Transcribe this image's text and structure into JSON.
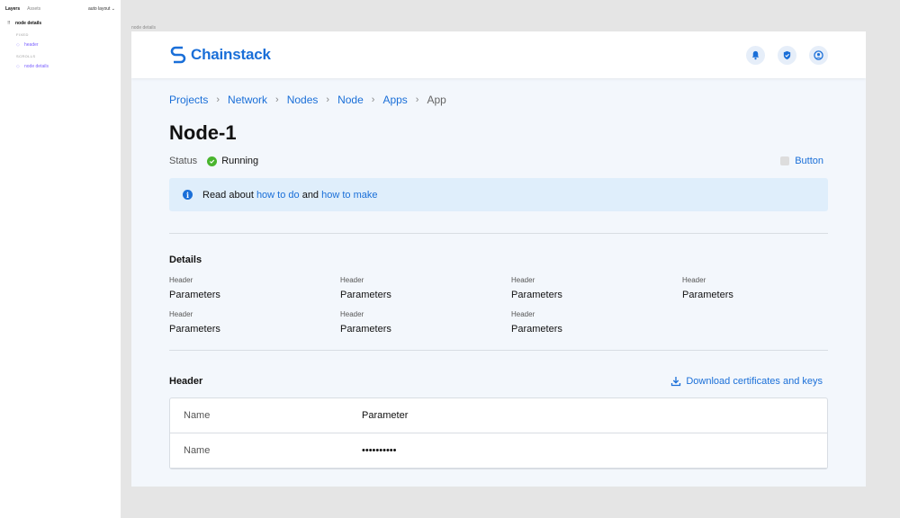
{
  "layers_panel": {
    "tabs": [
      "Layers",
      "Assets"
    ],
    "right_label": "auto layout",
    "root": "node details",
    "sections": [
      {
        "label": "FIXED",
        "item": "header"
      },
      {
        "label": "SCROLLS",
        "item": "node details"
      }
    ]
  },
  "frame_label": "node details",
  "brand": {
    "name": "Chainstack",
    "color": "#1a6fd8"
  },
  "header_icons": [
    "bell-icon",
    "shield-icon",
    "user-icon"
  ],
  "breadcrumb": [
    "Projects",
    "Network",
    "Nodes",
    "Node",
    "Apps",
    "App"
  ],
  "page": {
    "title": "Node-1",
    "status_label": "Status",
    "status_value": "Running",
    "status_color": "#49b52e",
    "button_label": "Button"
  },
  "info": {
    "text1": "Read about ",
    "link1": "how to do",
    "text2": " and ",
    "link2": "how to make"
  },
  "details": {
    "title": "Details",
    "items": [
      {
        "header": "Header",
        "value": "Parameters"
      },
      {
        "header": "Header",
        "value": "Parameters"
      },
      {
        "header": "Header",
        "value": "Parameters"
      },
      {
        "header": "Header",
        "value": "Parameters"
      },
      {
        "header": "Header",
        "value": "Parameters"
      },
      {
        "header": "Header",
        "value": "Parameters"
      },
      {
        "header": "Header",
        "value": "Parameters"
      }
    ]
  },
  "section2": {
    "title": "Header",
    "download_label": "Download certificates and keys",
    "rows": [
      {
        "name": "Name",
        "value": "Parameter"
      },
      {
        "name": "Name",
        "value": "••••••••••"
      }
    ]
  }
}
